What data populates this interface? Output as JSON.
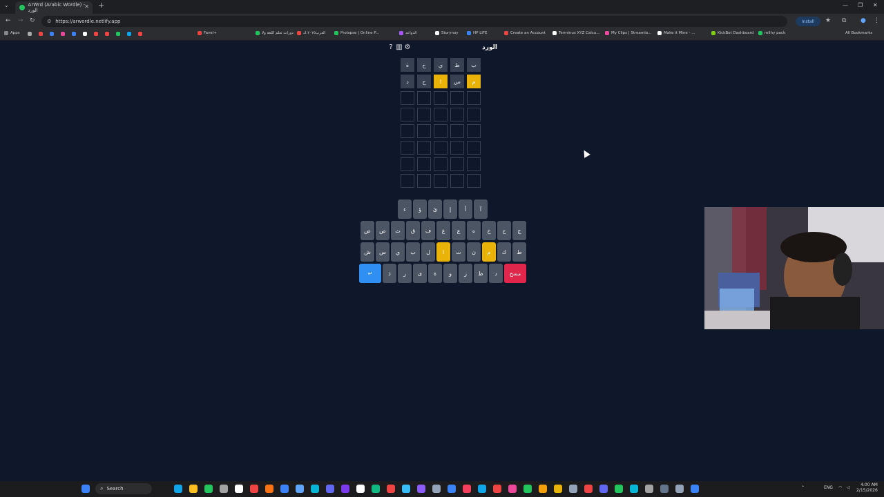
{
  "browser": {
    "tab_title": "ArWrd (Arabic Wordle) - الورد",
    "url": "https://arwordle.netlify.app",
    "install_label": "Install",
    "bookmarks": [
      "Apps",
      "Favel+",
      "دورات تعلم اللغة ولا",
      "العرب٢٠٢٥.ك",
      "Prolapse | Online P...",
      "الدواعد",
      "Storynoy",
      "HP LIFE",
      "Create an Account",
      "Terminus XYZ Calcu...",
      "My Clips | Streamla...",
      "Make it Mine - ...",
      "KickBot Dashboard",
      "rellhy pack"
    ],
    "all_bookmarks": "All Bookmarks"
  },
  "game": {
    "title": "الورد",
    "icons": [
      "help-icon",
      "stats-icon",
      "settings-icon"
    ],
    "rows": [
      [
        {
          "l": "ب",
          "s": "filled"
        },
        {
          "l": "ط",
          "s": "filled"
        },
        {
          "l": "ي",
          "s": "filled"
        },
        {
          "l": "خ",
          "s": "filled"
        },
        {
          "l": "ة",
          "s": "filled"
        }
      ],
      [
        {
          "l": "م",
          "s": "present"
        },
        {
          "l": "س",
          "s": "filled"
        },
        {
          "l": "ا",
          "s": "present"
        },
        {
          "l": "ح",
          "s": "filled"
        },
        {
          "l": "د",
          "s": "filled"
        }
      ],
      [
        {
          "l": "",
          "s": "empty"
        },
        {
          "l": "",
          "s": "empty"
        },
        {
          "l": "",
          "s": "empty"
        },
        {
          "l": "",
          "s": "empty"
        },
        {
          "l": "",
          "s": "empty"
        }
      ],
      [
        {
          "l": "",
          "s": "empty"
        },
        {
          "l": "",
          "s": "empty"
        },
        {
          "l": "",
          "s": "empty"
        },
        {
          "l": "",
          "s": "empty"
        },
        {
          "l": "",
          "s": "empty"
        }
      ],
      [
        {
          "l": "",
          "s": "empty"
        },
        {
          "l": "",
          "s": "empty"
        },
        {
          "l": "",
          "s": "empty"
        },
        {
          "l": "",
          "s": "empty"
        },
        {
          "l": "",
          "s": "empty"
        }
      ],
      [
        {
          "l": "",
          "s": "empty"
        },
        {
          "l": "",
          "s": "empty"
        },
        {
          "l": "",
          "s": "empty"
        },
        {
          "l": "",
          "s": "empty"
        },
        {
          "l": "",
          "s": "empty"
        }
      ],
      [
        {
          "l": "",
          "s": "empty"
        },
        {
          "l": "",
          "s": "empty"
        },
        {
          "l": "",
          "s": "empty"
        },
        {
          "l": "",
          "s": "empty"
        },
        {
          "l": "",
          "s": "empty"
        }
      ],
      [
        {
          "l": "",
          "s": "empty"
        },
        {
          "l": "",
          "s": "empty"
        },
        {
          "l": "",
          "s": "empty"
        },
        {
          "l": "",
          "s": "empty"
        },
        {
          "l": "",
          "s": "empty"
        }
      ]
    ],
    "keyboard": [
      [
        {
          "k": "آ",
          "s": ""
        },
        {
          "k": "أ",
          "s": ""
        },
        {
          "k": "إ",
          "s": ""
        },
        {
          "k": "ئ",
          "s": ""
        },
        {
          "k": "ؤ",
          "s": ""
        },
        {
          "k": "ء",
          "s": ""
        }
      ],
      [
        {
          "k": "ج",
          "s": ""
        },
        {
          "k": "ح",
          "s": ""
        },
        {
          "k": "خ",
          "s": ""
        },
        {
          "k": "ه",
          "s": ""
        },
        {
          "k": "ع",
          "s": ""
        },
        {
          "k": "غ",
          "s": ""
        },
        {
          "k": "ف",
          "s": ""
        },
        {
          "k": "ق",
          "s": ""
        },
        {
          "k": "ث",
          "s": ""
        },
        {
          "k": "ص",
          "s": ""
        },
        {
          "k": "ض",
          "s": ""
        }
      ],
      [
        {
          "k": "ط",
          "s": ""
        },
        {
          "k": "ك",
          "s": ""
        },
        {
          "k": "م",
          "s": "present"
        },
        {
          "k": "ن",
          "s": ""
        },
        {
          "k": "ت",
          "s": ""
        },
        {
          "k": "ا",
          "s": "present"
        },
        {
          "k": "ل",
          "s": ""
        },
        {
          "k": "ب",
          "s": ""
        },
        {
          "k": "ي",
          "s": ""
        },
        {
          "k": "س",
          "s": ""
        },
        {
          "k": "ش",
          "s": ""
        }
      ],
      [
        {
          "k": "مسح",
          "s": "del"
        },
        {
          "k": "د",
          "s": ""
        },
        {
          "k": "ظ",
          "s": ""
        },
        {
          "k": "ز",
          "s": ""
        },
        {
          "k": "و",
          "s": ""
        },
        {
          "k": "ة",
          "s": ""
        },
        {
          "k": "ى",
          "s": ""
        },
        {
          "k": "ر",
          "s": ""
        },
        {
          "k": "ذ",
          "s": ""
        },
        {
          "k": "↵",
          "s": "enter"
        }
      ]
    ]
  },
  "taskbar": {
    "search_label": "Search",
    "lang": "ENG",
    "time": "4:00 AM",
    "date": "2/15/2026"
  }
}
